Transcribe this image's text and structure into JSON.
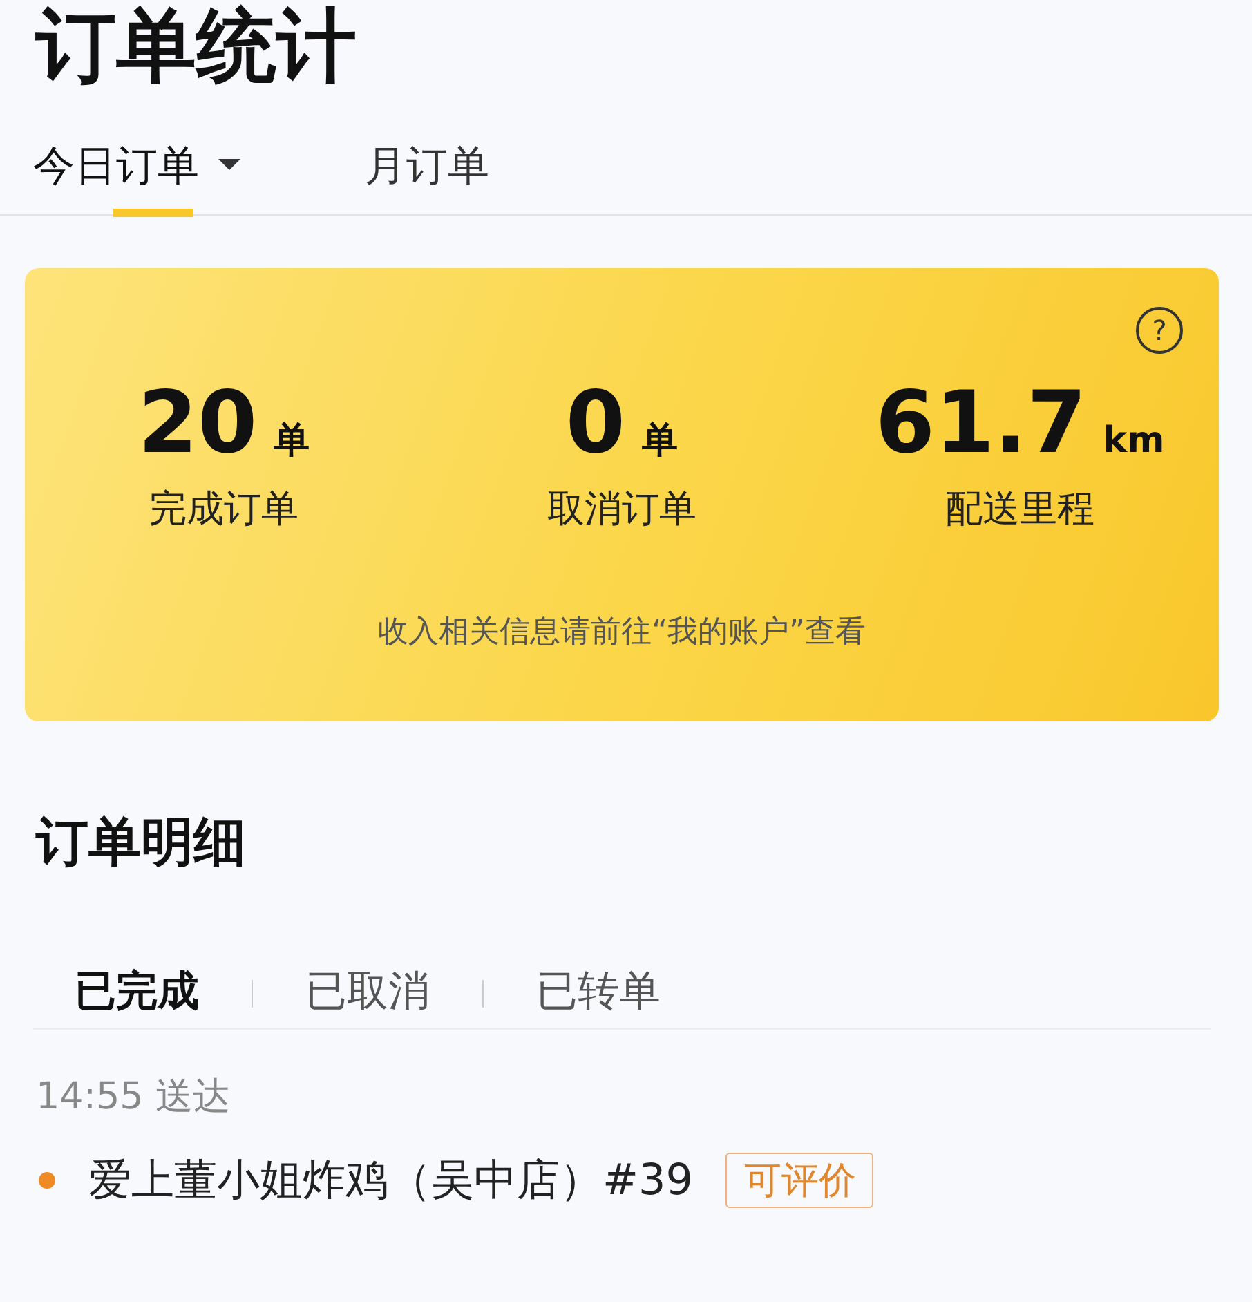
{
  "page_title": "订单统计",
  "tabs": [
    {
      "label": "今日订单",
      "selected": true,
      "dropdown": true
    },
    {
      "label": "月订单",
      "selected": false,
      "dropdown": false
    }
  ],
  "summary": {
    "stats": [
      {
        "value": "20",
        "unit": "单",
        "label": "完成订单"
      },
      {
        "value": "0",
        "unit": "单",
        "label": "取消订单"
      },
      {
        "value": "61.7",
        "unit": "km",
        "label": "配送里程"
      }
    ],
    "help_icon": "?",
    "note": "收入相关信息请前往“我的账户”查看"
  },
  "detail_title": "订单明细",
  "status_tabs": [
    {
      "label": "已完成",
      "selected": true
    },
    {
      "label": "已取消",
      "selected": false
    },
    {
      "label": "已转单",
      "selected": false
    }
  ],
  "orders": [
    {
      "time": "14:55 送达",
      "store": "爱上董小姐炸鸡（吴中店）#39",
      "badge": "可评价",
      "color": "#f08a24"
    }
  ]
}
